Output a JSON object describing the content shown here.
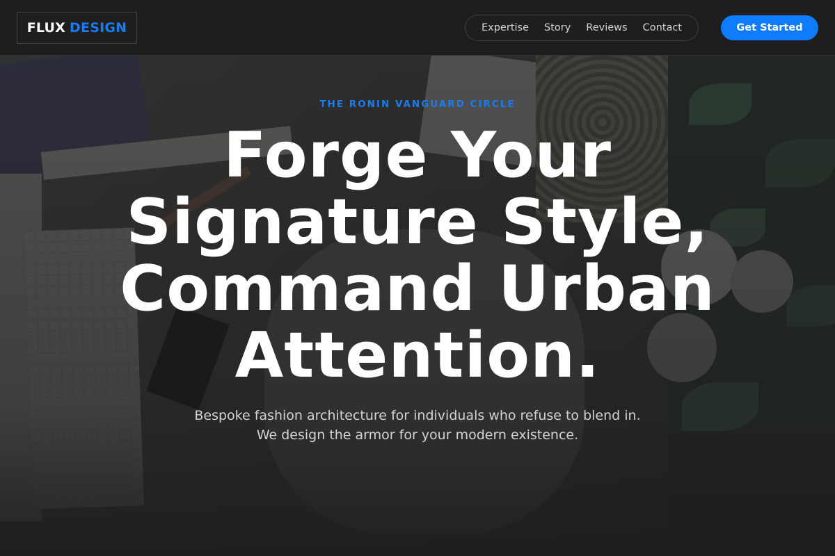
{
  "header": {
    "logo": {
      "part1": "FLUX",
      "part2": "DESIGN"
    },
    "nav": [
      {
        "label": "Expertise"
      },
      {
        "label": "Story"
      },
      {
        "label": "Reviews"
      },
      {
        "label": "Contact"
      }
    ],
    "cta_label": "Get Started"
  },
  "hero": {
    "eyebrow": "THE RONIN VANGUARD CIRCLE",
    "headline": "Forge Your Signature Style, Command Urban Attention.",
    "subheadline": "Bespoke fashion architecture for individuals who refuse to blend in. We design the armor for your modern existence."
  },
  "colors": {
    "accent": "#0f7bff",
    "background": "#1e1e1e",
    "text": "#ffffff"
  }
}
